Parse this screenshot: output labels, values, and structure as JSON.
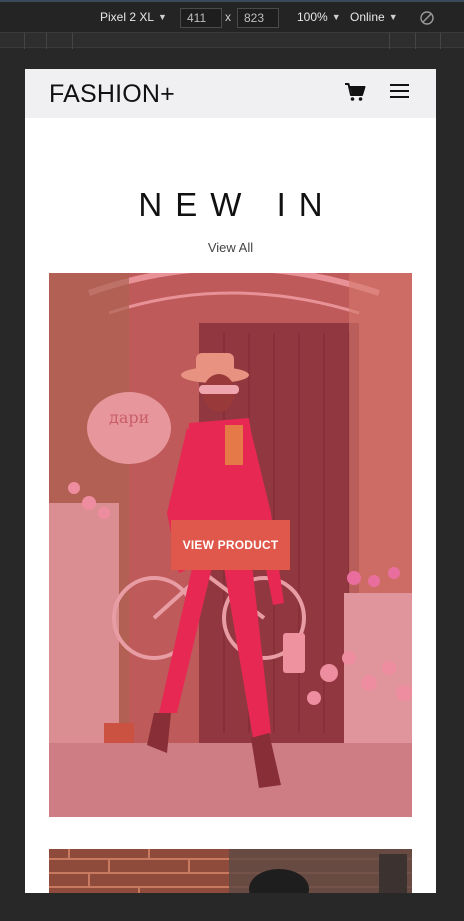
{
  "devtools": {
    "device": "Pixel 2 XL",
    "width": "411",
    "height": "823",
    "separator": "x",
    "zoom": "100%",
    "network": "Online"
  },
  "navbar": {
    "brand": "FASHION+"
  },
  "section": {
    "title": "NEW IN",
    "view_all": "View All"
  },
  "product": {
    "button_label": "VIEW PRODUCT"
  },
  "colors": {
    "accent": "#e0574b",
    "overlay": "#e9465a"
  }
}
